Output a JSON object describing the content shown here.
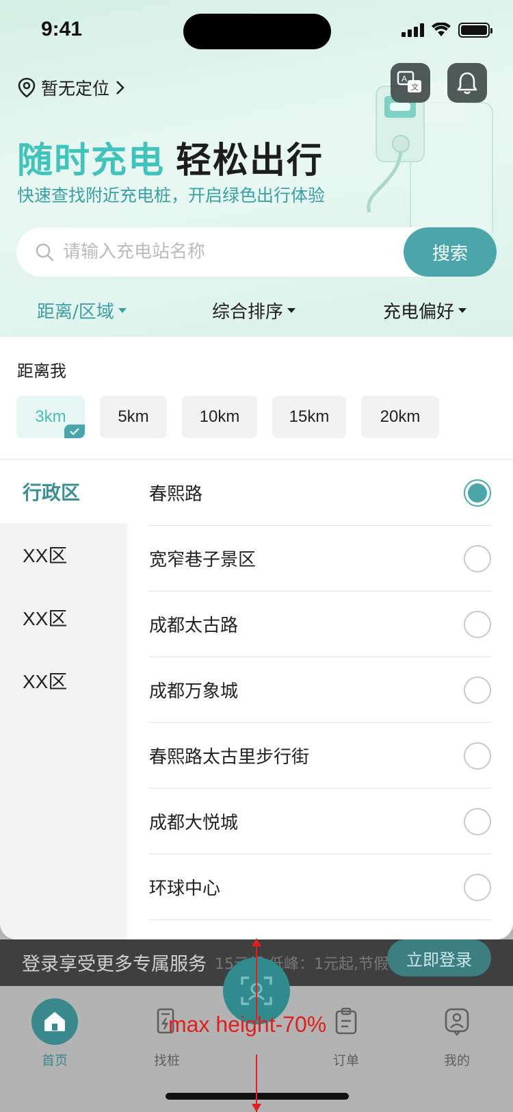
{
  "status_bar": {
    "time": "9:41"
  },
  "header": {
    "location": "暂无定位",
    "headline_accent": "随时充电",
    "headline_main": "轻松出行",
    "subline": "快速查找附近充电桩，开启绿色出行体验"
  },
  "search": {
    "placeholder": "请输入充电站名称",
    "button_label": "搜索"
  },
  "filters": [
    {
      "label": "距离/区域",
      "active": true
    },
    {
      "label": "综合排序",
      "active": false
    },
    {
      "label": "充电偏好",
      "active": false
    }
  ],
  "distance": {
    "title": "距离我",
    "options": [
      "3km",
      "5km",
      "10km",
      "15km",
      "20km"
    ],
    "selected": "3km"
  },
  "areas": {
    "categories": [
      "行政区",
      "XX区",
      "XX区",
      "XX区"
    ],
    "active_category": "行政区",
    "items": [
      "春熙路",
      "宽窄巷子景区",
      "成都太古路",
      "成都万象城",
      "春熙路太古里步行街",
      "成都大悦城",
      "环球中心"
    ],
    "selected_item": "春熙路"
  },
  "background": {
    "login_text": "登录享受更多专属服务",
    "ghost_text": "15元起 低峰：1元起,节假",
    "login_button": "立即登录"
  },
  "tabbar": {
    "tabs": [
      "首页",
      "找桩",
      "订单",
      "我的"
    ],
    "active": "首页"
  },
  "annotation": {
    "label": "max height-70%"
  },
  "colors": {
    "accent": "#4aa6aa",
    "headline_accent": "#3fc3bb",
    "annotation": "#e02020"
  }
}
